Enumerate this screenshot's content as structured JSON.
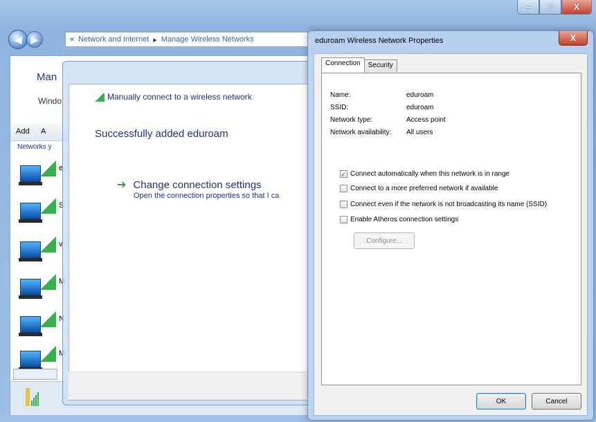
{
  "outer": {
    "caption": {
      "minimize": "–",
      "maximize": "□",
      "close": "X"
    },
    "breadcrumb": [
      "Network and Internet",
      "Manage Wireless Networks"
    ],
    "breadcrumb_prefix": "«",
    "breadcrumb_sep": "▸",
    "title_partial": "Man",
    "subtitle_partial": "Windo",
    "toolbar": {
      "add": "Add",
      "add2": "A"
    },
    "networks_header": "Networks y",
    "network_items": [
      "e",
      "S",
      "v",
      "M",
      "N",
      "M"
    ]
  },
  "wizard": {
    "header": "Manually connect to a wireless network",
    "title": "Successfully added eduroam",
    "link": {
      "arrow": "➔",
      "label": "Change connection settings",
      "description": "Open the connection properties so that I ca"
    }
  },
  "dialog": {
    "title": "eduroam Wireless Network Properties",
    "close": "X",
    "tabs": [
      {
        "label": "Connection"
      },
      {
        "label": "Security"
      }
    ],
    "fields": [
      {
        "key": "Name:",
        "value": "eduroam"
      },
      {
        "key": "SSID:",
        "value": "eduroam"
      },
      {
        "key": "Network type:",
        "value": "Access point"
      },
      {
        "key": "Network availability:",
        "value": "All users"
      }
    ],
    "checks": [
      {
        "label": "Connect automatically when this network is in range",
        "checked": true,
        "mark": "✓"
      },
      {
        "label": "Connect to a more preferred network if available",
        "checked": false,
        "mark": ""
      },
      {
        "label": "Connect even if the network is not broadcasting its name (SSID)",
        "checked": false,
        "mark": ""
      },
      {
        "label": "Enable Atheros connection settings",
        "checked": false,
        "mark": ""
      }
    ],
    "configure": "Configure...",
    "ok": "OK",
    "cancel": "Cancel"
  }
}
